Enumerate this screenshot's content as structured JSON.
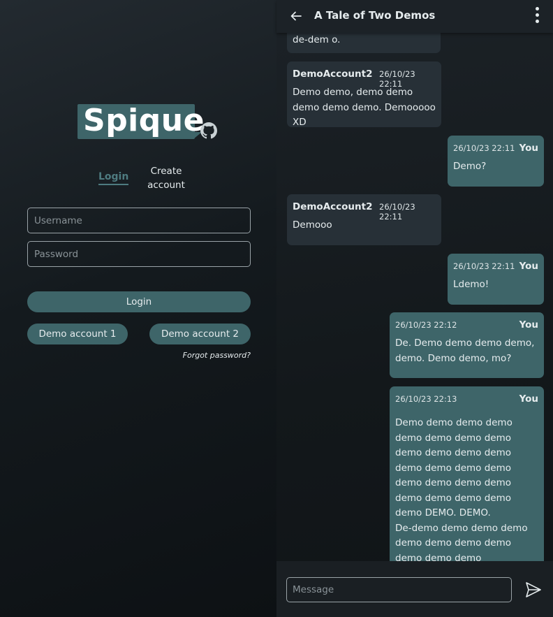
{
  "login": {
    "logo_text": "Spique",
    "tabs": {
      "login": "Login",
      "create": "Create account"
    },
    "username_placeholder": "Username",
    "password_placeholder": "Password",
    "login_button": "Login",
    "demo1_button": "Demo account 1",
    "demo2_button": "Demo account 2",
    "forgot_link": "Forgot password?",
    "icons": {
      "github": "github-icon"
    }
  },
  "chat": {
    "title": "A Tale of Two Demos",
    "icons": {
      "back": "arrow-left-icon",
      "menu": "kebab-menu-icon",
      "send": "send-icon"
    },
    "messages": [
      {
        "author": "",
        "time": "",
        "body": "de-dem o."
      },
      {
        "author": "DemoAccount2",
        "time": "26/10/23 22:11",
        "body": "Demo demo, demo demo demo demo demo. Demooooo XD"
      },
      {
        "author": "You",
        "time": "26/10/23 22:11",
        "body": "Demo?"
      },
      {
        "author": "DemoAccount2",
        "time": "26/10/23 22:11",
        "body": "Demooo"
      },
      {
        "author": "You",
        "time": "26/10/23 22:11",
        "body": "Ldemo!"
      },
      {
        "author": "You",
        "time": "26/10/23 22:12",
        "body": "De. Demo demo demo demo, demo. Demo demo, mo?"
      },
      {
        "author": "You",
        "time": "26/10/23 22:13",
        "body": "Demo demo demo demo demo demo demo demo demo demo demo demo demo demo demo demo demo demo demo demo demo demo demo demo demo DEMO. DEMO.\nDe-demo demo demo demo demo demo demo demo demo demo demo"
      }
    ],
    "message_placeholder": "Message"
  },
  "colors": {
    "accent": "#3e6569",
    "incoming_bubble": "#273037",
    "link_active": "#4e7b80"
  }
}
